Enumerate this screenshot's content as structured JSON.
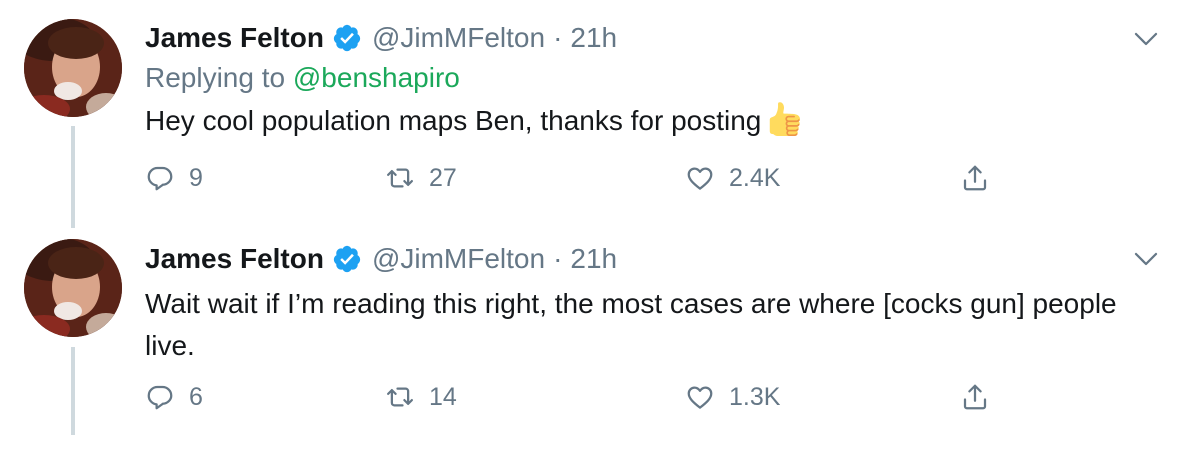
{
  "tweets": [
    {
      "author_name": "James Felton",
      "handle": "@JimMFelton",
      "separator": "·",
      "time": "21h",
      "replying_to_prefix": "Replying to",
      "replying_to_user": "@benshapiro",
      "text": "Hey cool population maps Ben, thanks for posting",
      "emoji": "thumbs-up",
      "replies": "9",
      "retweets": "27",
      "likes": "2.4K"
    },
    {
      "author_name": "James Felton",
      "handle": "@JimMFelton",
      "separator": "·",
      "time": "21h",
      "text": "Wait wait if I’m reading this right, the most cases are where [cocks gun] people live.",
      "replies": "6",
      "retweets": "14",
      "likes": "1.3K"
    }
  ],
  "colors": {
    "text": "#14171a",
    "secondary": "#657786",
    "verified": "#1da1f2",
    "mention": "#1ba85a",
    "thread_line": "#cfd9de"
  }
}
